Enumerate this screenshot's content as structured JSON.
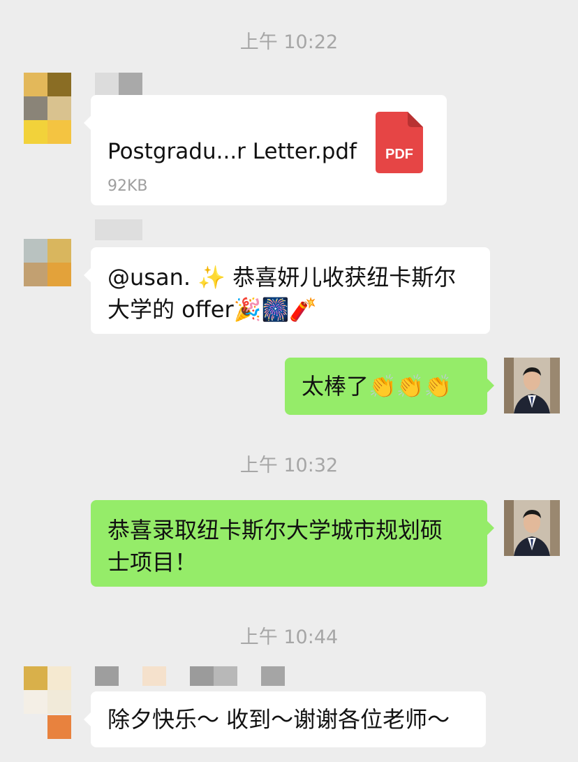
{
  "timestamps": [
    "上午 10:22",
    "上午 10:32",
    "上午 10:44"
  ],
  "messages": {
    "file": {
      "name": "Postgradu...r Letter.pdf",
      "size": "92KB",
      "icon_label": "PDF",
      "icon": "pdf-file-icon"
    },
    "congrats_mention": {
      "line1": "@usan. ✨ 恭喜妍儿收获纽卡斯尔",
      "line2": "大学的 offer🎉🎆🧨"
    },
    "reply_great": "太棒了👏👏👏",
    "reply_admitted": {
      "line1": "恭喜录取纽卡斯尔大学城市规划硕",
      "line2": "士项目！"
    },
    "new_year": "除夕快乐～ 收到～谢谢各位老师～"
  },
  "colors": {
    "background": "#ededed",
    "incoming_bubble": "#ffffff",
    "outgoing_bubble": "#95ec69",
    "timestamp_text": "#a6a6a6",
    "pdf_red": "#e64545"
  }
}
